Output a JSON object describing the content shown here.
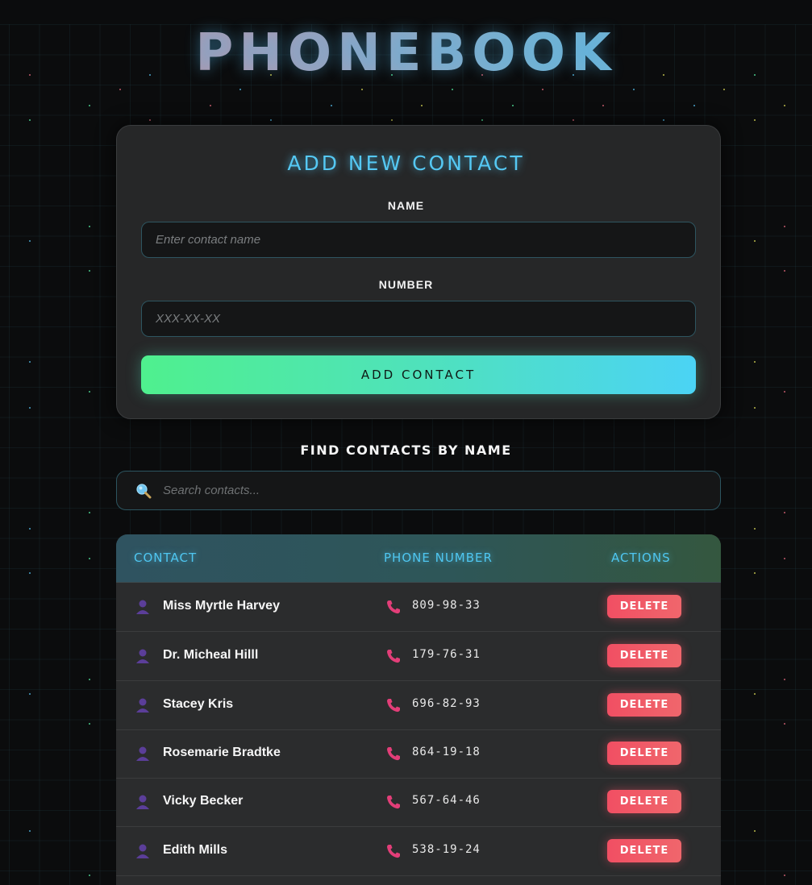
{
  "app": {
    "title": "PHONEBOOK"
  },
  "form": {
    "heading": "ADD NEW CONTACT",
    "name_label": "NAME",
    "name_placeholder": "Enter contact name",
    "number_label": "NUMBER",
    "number_placeholder": "XXX-XX-XX",
    "submit_label": "ADD CONTACT"
  },
  "search": {
    "label": "FIND CONTACTS BY NAME",
    "placeholder": "Search contacts...",
    "icon": "search-icon"
  },
  "table": {
    "columns": [
      "CONTACT",
      "PHONE NUMBER",
      "ACTIONS"
    ],
    "delete_label": "DELETE",
    "rows": [
      {
        "name": "Miss Myrtle Harvey",
        "number": "809-98-33"
      },
      {
        "name": "Dr. Micheal Hilll",
        "number": "179-76-31"
      },
      {
        "name": "Stacey Kris",
        "number": "696-82-93"
      },
      {
        "name": "Rosemarie Bradtke",
        "number": "864-19-18"
      },
      {
        "name": "Vicky Becker",
        "number": "567-64-46"
      },
      {
        "name": "Edith Mills",
        "number": "538-19-24"
      }
    ]
  },
  "colors": {
    "accent": "#55c8f3",
    "button_gradient_start": "#4ff08e",
    "button_gradient_end": "#4bd3f5",
    "delete": "#f14f63"
  }
}
